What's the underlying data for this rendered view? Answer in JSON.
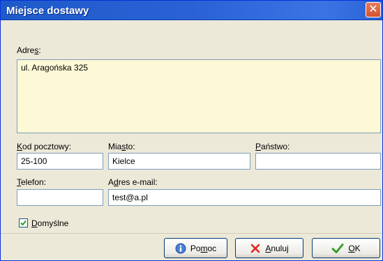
{
  "window": {
    "title": "Miejsce dostawy",
    "close_glyph": "✕"
  },
  "address": {
    "label_pre": "Adre",
    "label_key": "s",
    "label_post": ":",
    "value": "ul. Aragońska 325"
  },
  "postal_code": {
    "label_key": "K",
    "label_post": "od pocztowy:",
    "value": "25-100"
  },
  "city": {
    "label_pre": "Mia",
    "label_key": "s",
    "label_post": "to:",
    "value": "Kielce"
  },
  "country": {
    "label_key": "P",
    "label_post": "aństwo:",
    "value": ""
  },
  "phone": {
    "label_key": "T",
    "label_post": "elefon:",
    "value": ""
  },
  "email": {
    "label_pre": "A",
    "label_key": "d",
    "label_post": "res e-mail:",
    "value": "test@a.pl"
  },
  "default_checkbox": {
    "label_key": "D",
    "label_post": "omyślne",
    "checked": true
  },
  "buttons": {
    "help": {
      "pre": "Po",
      "key": "m",
      "post": "oc",
      "icon": "info-icon"
    },
    "cancel": {
      "pre": "",
      "key": "A",
      "post": "nuluj",
      "icon": "x-icon"
    },
    "ok": {
      "pre": "",
      "key": "O",
      "post": "K",
      "icon": "checkmark-icon"
    }
  },
  "colors": {
    "titlebar": "#2a62d6",
    "window_bg": "#ece9d8",
    "address_bg": "#fdf9d6",
    "field_border": "#7f9db9",
    "close_button": "#d2542e"
  }
}
